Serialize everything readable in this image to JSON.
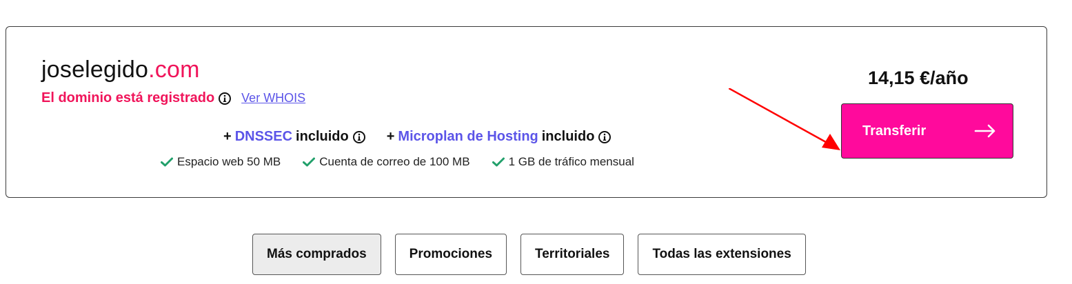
{
  "domain": {
    "name": "joselegido",
    "tld": ".com",
    "status": "El dominio está registrado",
    "whois_link": "Ver WHOIS"
  },
  "features": [
    {
      "prefix": "+",
      "name": "DNSSEC",
      "suffix": "incluido"
    },
    {
      "prefix": "+",
      "name": "Microplan de Hosting",
      "suffix": "incluido"
    }
  ],
  "specs": [
    "Espacio web 50 MB",
    "Cuenta de correo de 100 MB",
    "1 GB de tráfico mensual"
  ],
  "price": "14,15 €/año",
  "transfer_button": {
    "label": "Transferir"
  },
  "tabs": [
    {
      "label": "Más comprados",
      "active": true
    },
    {
      "label": "Promociones",
      "active": false
    },
    {
      "label": "Territoriales",
      "active": false
    },
    {
      "label": "Todas las extensiones",
      "active": false
    }
  ],
  "colors": {
    "brand_pink": "#ff0a9c",
    "status_red": "#f0145a",
    "accent_blue": "#5b54e8",
    "check_green": "#22a06b",
    "annotation_red": "#ff0000"
  },
  "icons": {
    "info": "info-circle-icon",
    "check": "check-icon",
    "arrow": "arrow-right-icon",
    "annotation": "red-annotation-arrow"
  }
}
